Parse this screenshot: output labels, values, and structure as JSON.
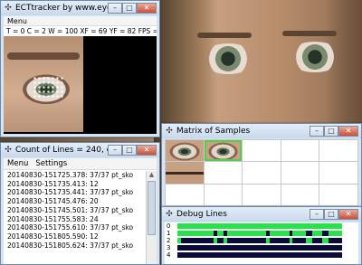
{
  "ect_window": {
    "title": "ECTtracker by www.eyeco...",
    "menu_label": "Menu",
    "status_line": "T = 0 C = 2  W = 100 XF = 69 YF = 82 FPS = 16.1"
  },
  "count_window": {
    "title": "Count of Lines = 240, cou...",
    "menu": [
      "Menu",
      "Settings"
    ],
    "lines": [
      "20140830-151725.378: 37/37 pt_sko",
      "20140830-151735.413: 12",
      "20140830-151735.441: 37/37 pt_sko",
      "20140830-151745.476: 20",
      "20140830-151745.501: 37/37 pt_sko",
      "20140830-151755.583: 24",
      "20140830-151755.610: 37/37 pt_sko",
      "20140830-151805.590: 12",
      "20140830-151805.624: 37/37 pt_sko"
    ]
  },
  "matrix_window": {
    "title": "Matrix of Samples"
  },
  "debug_window": {
    "title": "Debug Lines",
    "row_labels": [
      "0",
      "1",
      "2",
      "3",
      "4"
    ]
  },
  "colors": {
    "debug_active": "#27e34a",
    "debug_track": "#0b0b3a",
    "selected_sample": "#4fd14f"
  }
}
